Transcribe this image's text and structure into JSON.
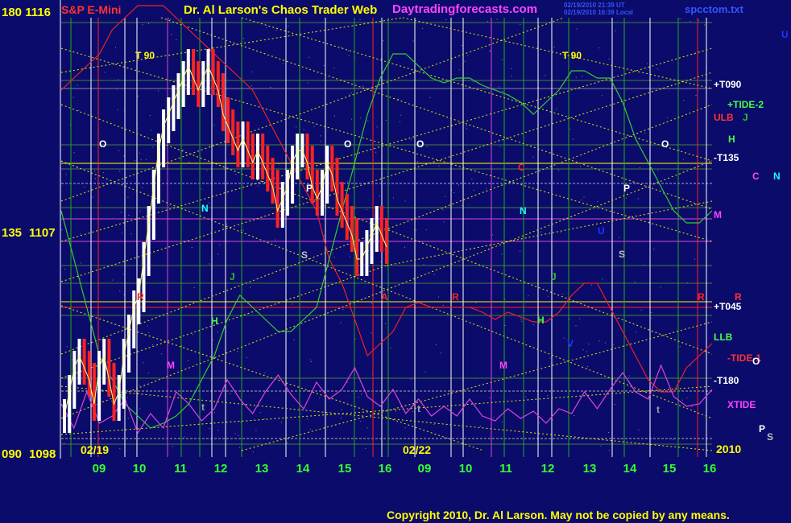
{
  "header": {
    "left_price_top": "180  1116",
    "instrument": "S&P E-Mini",
    "title": "Dr. Al Larson's Chaos Trader Web",
    "site": "Daytradingforecasts.com",
    "stamp_line1": "02/19/2010 21:39 UT",
    "stamp_line2": "02/19/2010 16:39 Local",
    "filename": "spcctom.txt"
  },
  "footer": {
    "copyright": "Copyright 2010, Dr. Al Larson. May not be copied by any means.",
    "year": "2010"
  },
  "chart_data": {
    "type": "line",
    "title": "S&P E-Mini",
    "y_axis_labels": [
      {
        "deg": "180",
        "price": "1116",
        "value": 1116
      },
      {
        "deg": "135",
        "price": "1107",
        "value": 1107
      },
      {
        "deg": "090",
        "price": "1098",
        "value": 1098
      }
    ],
    "ylim": [
      1098,
      1116
    ],
    "date_labels": [
      "02/19",
      "02/22"
    ],
    "x_tick_labels": [
      "09",
      "10",
      "11",
      "12",
      "13",
      "14",
      "15",
      "16",
      "09",
      "10",
      "11",
      "12",
      "13",
      "14",
      "15",
      "16"
    ],
    "right_labels": [
      {
        "text": "+T090",
        "color": "#ffffff"
      },
      {
        "text": "+TIDE-2",
        "color": "#44ff44"
      },
      {
        "text": "ULB",
        "color": "#ff3333"
      },
      {
        "text": "J",
        "color": "#22cc22"
      },
      {
        "text": "H",
        "color": "#44ff44"
      },
      {
        "text": "-T135",
        "color": "#ffffff"
      },
      {
        "text": "C",
        "color": "#ff44ff"
      },
      {
        "text": "N",
        "color": "#22ffff"
      },
      {
        "text": "M",
        "color": "#ff44ff"
      },
      {
        "text": "R",
        "color": "#ff3333"
      },
      {
        "text": "+T045",
        "color": "#ffffff"
      },
      {
        "text": "LLB",
        "color": "#44ff44"
      },
      {
        "text": "-TIDE-1",
        "color": "#ff3333"
      },
      {
        "text": "O",
        "color": "#ffffff"
      },
      {
        "text": "-T180",
        "color": "#ffffff"
      },
      {
        "text": "XTIDE",
        "color": "#ff44ff"
      },
      {
        "text": "P",
        "color": "#ffffff"
      },
      {
        "text": "S",
        "color": "#c0c0c0"
      },
      {
        "text": "U",
        "color": "#2233ff"
      }
    ],
    "in_chart_labels": [
      {
        "text": "T  90",
        "color": "#ffff00"
      },
      {
        "text": "T  90",
        "color": "#ffff00"
      },
      {
        "text": "O",
        "color": "#ffffff"
      },
      {
        "text": "O",
        "color": "#ffffff"
      },
      {
        "text": "O",
        "color": "#ffffff"
      },
      {
        "text": "O",
        "color": "#ffffff"
      },
      {
        "text": "C",
        "color": "#ff2222"
      },
      {
        "text": "N",
        "color": "#22ffff"
      },
      {
        "text": "P",
        "color": "#ffffff"
      },
      {
        "text": "P",
        "color": "#ffffff"
      },
      {
        "text": "S",
        "color": "#c0c0c0"
      },
      {
        "text": "S",
        "color": "#c0c0c0"
      },
      {
        "text": "J",
        "color": "#22cc22"
      },
      {
        "text": "J",
        "color": "#22cc22"
      },
      {
        "text": "H",
        "color": "#44ff44"
      },
      {
        "text": "H",
        "color": "#44ff44"
      },
      {
        "text": "M",
        "color": "#ff44ff"
      },
      {
        "text": "M",
        "color": "#ff44ff"
      },
      {
        "text": "V",
        "color": "#2233ff"
      },
      {
        "text": "U",
        "color": "#2233ff"
      },
      {
        "text": "R",
        "color": "#ff2222"
      },
      {
        "text": "R",
        "color": "#ff2222"
      },
      {
        "text": "R",
        "color": "#ff2222"
      },
      {
        "text": "t",
        "color": "#a0a0a0"
      },
      {
        "text": "t",
        "color": "#a0a0a0"
      },
      {
        "text": "t",
        "color": "#a0a0a0"
      },
      {
        "text": "A",
        "color": "#ff2222"
      },
      {
        "text": "N",
        "color": "#22ffff"
      }
    ],
    "series": [
      {
        "name": "S&P E-Mini",
        "style": "bars",
        "values": [
          1099.5,
          1100.5,
          1101.5,
          1102,
          1101.5,
          1101,
          1100,
          1101.5,
          1102,
          1101,
          1100,
          1100.5,
          1102,
          1103,
          1104,
          1104.5,
          1106,
          1107.5,
          1109,
          1110.5,
          1111.5,
          1112,
          1112.5,
          1113,
          1113.5,
          1114,
          1113.5,
          1113,
          1113.5,
          1114,
          1113.5,
          1113,
          1112,
          1111.5,
          1111,
          1110.5,
          1111,
          1110.5,
          1110,
          1110.5,
          1110,
          1109.5,
          1109,
          1108,
          1108.5,
          1109,
          1110,
          1110.5,
          1110.5,
          1110,
          1109,
          1108.5,
          1109,
          1110,
          1109.5,
          1108.5,
          1108,
          1107.5,
          1107,
          1106,
          1106,
          1106.5,
          1107,
          1107.5,
          1107,
          1106.5
        ]
      },
      {
        "name": "ULB",
        "color": "#ee2222",
        "values": [
          1113,
          1113.5,
          1114,
          1114.5,
          1115.5,
          1116,
          1116.5,
          1116.5,
          1116.5,
          1116,
          1115.5,
          1115,
          1114.5,
          1114,
          1113.5,
          1113,
          1112,
          1111,
          1110,
          1109,
          1108,
          1106,
          1105,
          1103.5,
          1102,
          1102.5,
          1103,
          1104,
          1104.2,
          1104,
          1104,
          1104,
          1104,
          1103.8,
          1103.5,
          1103.8,
          1103.6,
          1103.4,
          1103.4,
          1103.8,
          1104.5,
          1105,
          1105,
          1104,
          1103,
          1102,
          1101,
          1100.5,
          1100.5,
          1101.5,
          1102,
          1102.5
        ]
      },
      {
        "name": "LLB",
        "color": "#33cc33",
        "values": [
          1108,
          1106,
          1104,
          1102,
          1101,
          1100,
          1099.5,
          1099,
          1099.2,
          1099.5,
          1100,
          1101,
          1102,
          1103.5,
          1104.5,
          1104,
          1103.5,
          1103,
          1103,
          1103.5,
          1104,
          1106,
          1108,
          1110,
          1112,
          1113.5,
          1114.5,
          1114.5,
          1114,
          1113.5,
          1113.3,
          1113.5,
          1113.5,
          1113.2,
          1113,
          1112.8,
          1112.5,
          1112,
          1112.5,
          1113,
          1113.8,
          1113.8,
          1113.5,
          1113.5,
          1112.5,
          1111,
          1110,
          1109,
          1108,
          1107.5,
          1107.5,
          1108
        ]
      },
      {
        "name": "XTIDE",
        "color": "#dd44dd",
        "values": [
          1100,
          1099,
          1100.5,
          1099.2,
          1099.5,
          1100.2,
          1098.8,
          1099.6,
          1099,
          1100.5,
          1100,
          1099.3,
          1099.8,
          1101,
          1100.2,
          1099.6,
          1100.5,
          1101.2,
          1100.4,
          1099.8,
          1100.9,
          1100.2,
          1100.6,
          1101.5,
          1100.3,
          1099.9,
          1100.6,
          1099.6,
          1100.2,
          1099.5,
          1099.9,
          1099.5,
          1100.2,
          1099.5,
          1099.3,
          1099.8,
          1099.4,
          1099.7,
          1099.2,
          1099.8,
          1099.6,
          1100.5,
          1099.8,
          1100.6,
          1101.3,
          1100.5,
          1100.2,
          1101.6,
          1100.3,
          1099.9,
          1100,
          1100.6
        ]
      }
    ]
  }
}
